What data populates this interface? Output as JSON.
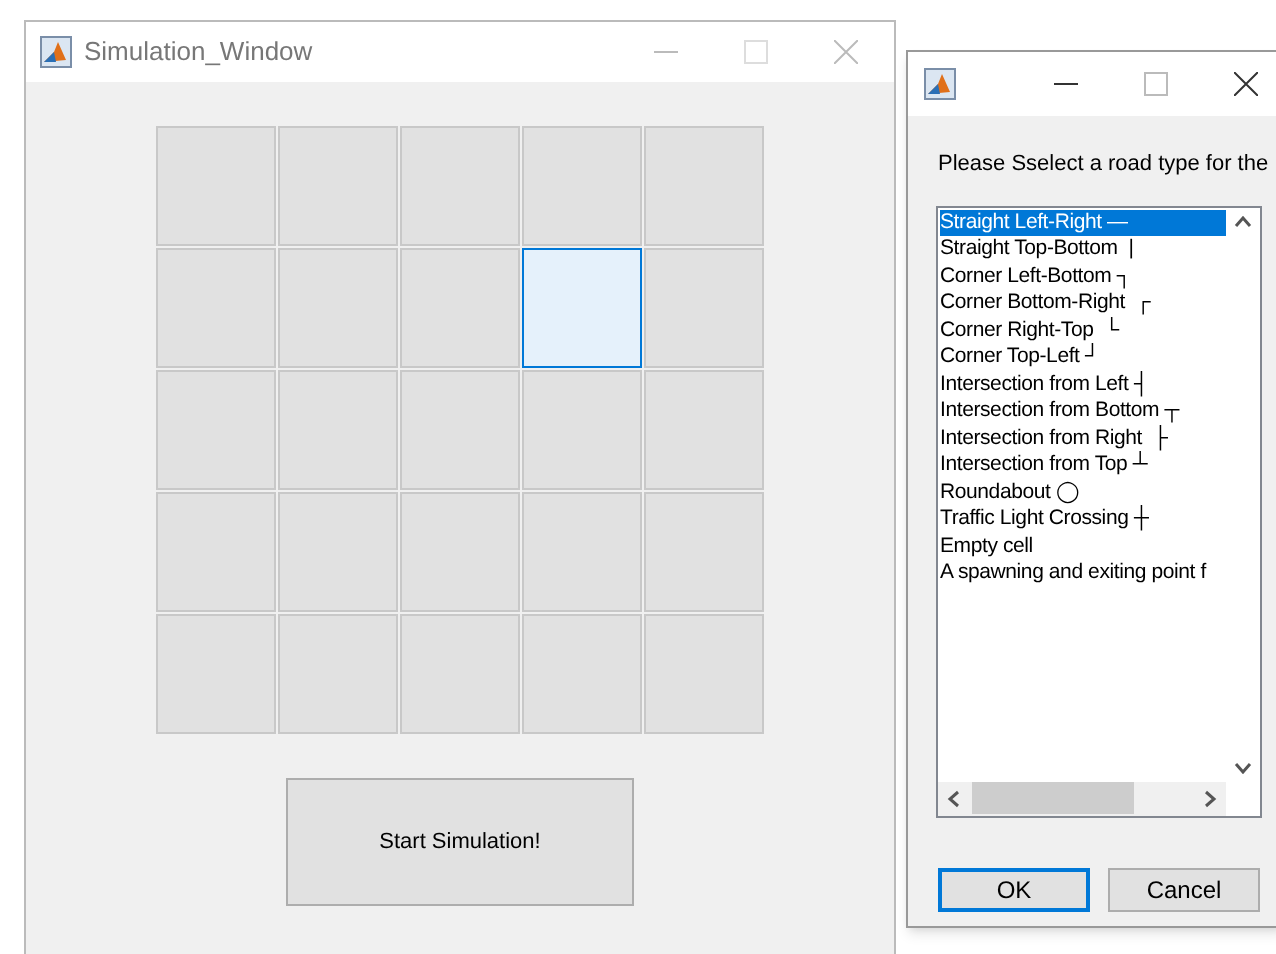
{
  "main_window": {
    "title": "Simulation_Window",
    "grid": [
      [
        {
          "selected": false
        },
        {
          "selected": false
        },
        {
          "selected": false
        },
        {
          "selected": false
        },
        {
          "selected": false
        }
      ],
      [
        {
          "selected": false
        },
        {
          "selected": false
        },
        {
          "selected": false
        },
        {
          "selected": true
        },
        {
          "selected": false
        }
      ],
      [
        {
          "selected": false
        },
        {
          "selected": false
        },
        {
          "selected": false
        },
        {
          "selected": false
        },
        {
          "selected": false
        }
      ],
      [
        {
          "selected": false
        },
        {
          "selected": false
        },
        {
          "selected": false
        },
        {
          "selected": false
        },
        {
          "selected": false
        }
      ],
      [
        {
          "selected": false
        },
        {
          "selected": false
        },
        {
          "selected": false
        },
        {
          "selected": false
        },
        {
          "selected": false
        }
      ]
    ],
    "start_button": "Start Simulation!"
  },
  "dialog": {
    "prompt": "Please Sselect a road type for the",
    "options": [
      {
        "label": "Straight Left-Right —",
        "selected": true
      },
      {
        "label": "Straight Top-Bottom  |",
        "selected": false
      },
      {
        "label": "Corner Left-Bottom ┐",
        "selected": false
      },
      {
        "label": "Corner Bottom-Right  ┌",
        "selected": false
      },
      {
        "label": "Corner Right-Top  └",
        "selected": false
      },
      {
        "label": "Corner Top-Left ┘",
        "selected": false
      },
      {
        "label": "Intersection from Left ┤",
        "selected": false
      },
      {
        "label": "Intersection from Bottom ┬",
        "selected": false
      },
      {
        "label": "Intersection from Right  ├",
        "selected": false
      },
      {
        "label": "Intersection from Top ┴",
        "selected": false
      },
      {
        "label": "Roundabout ◯",
        "selected": false
      },
      {
        "label": "Traffic Light Crossing ┼",
        "selected": false
      },
      {
        "label": "Empty cell",
        "selected": false
      },
      {
        "label": "A spawning and exiting point f",
        "selected": false
      }
    ],
    "buttons": [
      {
        "label": "OK",
        "selected": true
      },
      {
        "label": "Cancel",
        "selected": false
      }
    ]
  }
}
